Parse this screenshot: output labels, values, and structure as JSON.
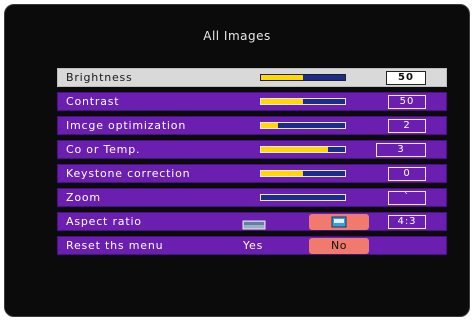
{
  "menu": {
    "title": "All Images",
    "rows": [
      {
        "label": "Brightness",
        "level": 0.5,
        "value": "50",
        "selected": true
      },
      {
        "label": "Contrast",
        "level": 0.5,
        "value": "50"
      },
      {
        "label": "Imcge optimization",
        "level": 0.2,
        "value": "2"
      },
      {
        "label": "Co or Temp.",
        "level": 0.8,
        "value": "3"
      },
      {
        "label": "Keystone correction",
        "level": 0.5,
        "value": "0"
      },
      {
        "label": "Zoom",
        "level": 0.0,
        "value": "`"
      },
      {
        "label": "Aspect ratio",
        "value": "4:3",
        "icons": [
          "wide-screen-icon",
          "standard-screen-icon"
        ]
      },
      {
        "label": "Reset ths menu",
        "option_yes": "Yes",
        "option_no": "No"
      }
    ]
  },
  "colors": {
    "row_bg": "#6a1fb0",
    "selected_bg": "#d9d9d9",
    "slider_track": "#1a2d8c",
    "slider_fill": "#ffd800",
    "button_highlight": "#f07a6e"
  }
}
